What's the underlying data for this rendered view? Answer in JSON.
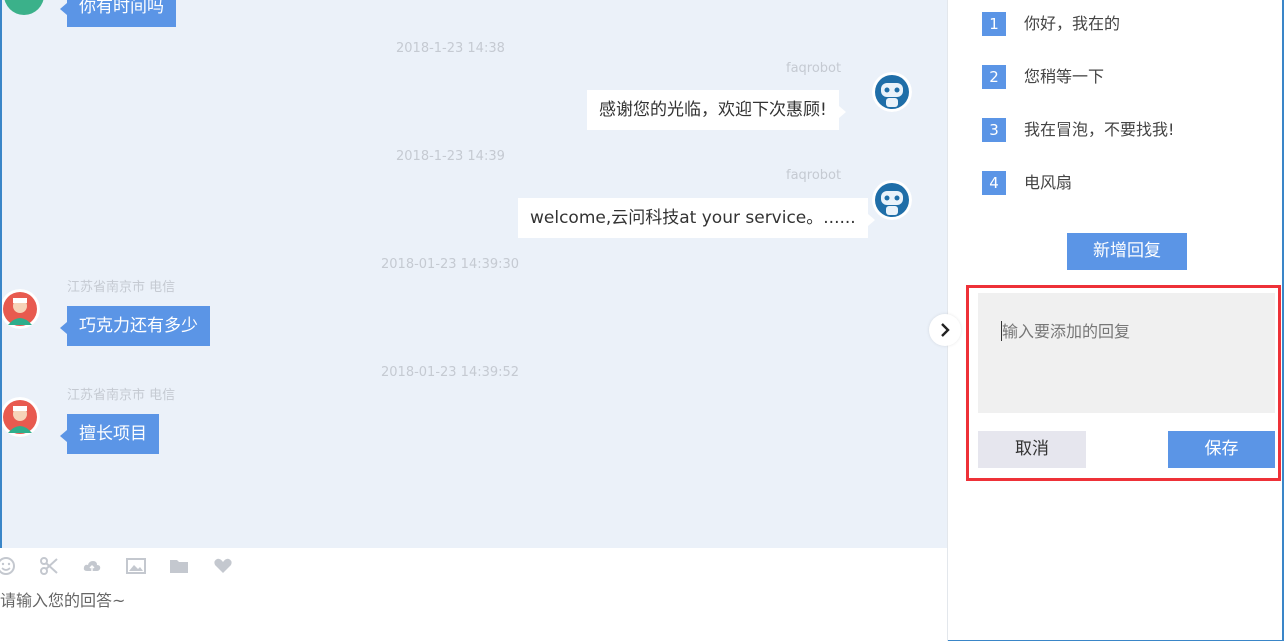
{
  "chat": {
    "top_bubble": "你有时间吗",
    "messages": [
      {
        "timestamp": "2018-1-23 14:38",
        "sender": "faqrobot",
        "text": "感谢您的光临，欢迎下次惠顾!"
      },
      {
        "timestamp": "2018-1-23 14:39",
        "sender": "faqrobot",
        "text": "welcome,云问科技at your service。......"
      },
      {
        "timestamp": "2018-01-23 14:39:30",
        "sender": "江苏省南京市 电信",
        "text": "巧克力还有多少"
      },
      {
        "timestamp": "2018-01-23 14:39:52",
        "sender": "江苏省南京市 电信",
        "text": "擅长项目"
      }
    ]
  },
  "composer": {
    "placeholder": "请输入您的回答~",
    "tools": [
      "emoji-icon",
      "scissors-icon",
      "cloud-upload-icon",
      "image-icon",
      "folder-icon",
      "heart-icon"
    ]
  },
  "quick_replies": {
    "items": [
      {
        "num": "1",
        "text": "你好，我在的"
      },
      {
        "num": "2",
        "text": "您稍等一下"
      },
      {
        "num": "3",
        "text": "我在冒泡，不要找我!"
      },
      {
        "num": "4",
        "text": "电风扇"
      }
    ],
    "add_button": "新增回复",
    "input_placeholder": "输入要添加的回复",
    "cancel_button": "取消",
    "save_button": "保存"
  },
  "colors": {
    "accent": "#5b95e6",
    "chat_bg": "#ebf1f9",
    "highlight": "#ee3138"
  }
}
